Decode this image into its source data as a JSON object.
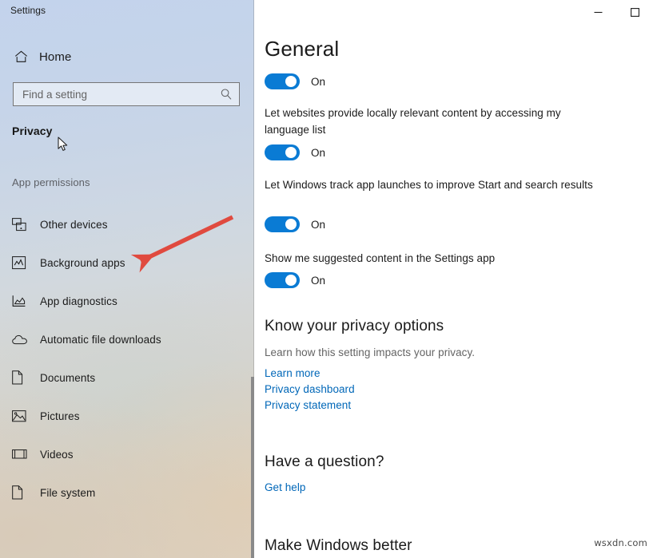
{
  "window": {
    "title": "Settings",
    "buttons": [
      {
        "name": "minimize",
        "glyph": "—"
      },
      {
        "name": "maximize",
        "glyph": "☐"
      }
    ]
  },
  "sidebar": {
    "home_label": "Home",
    "home_icon": "home-icon",
    "search": {
      "placeholder": "Find a setting",
      "value": "",
      "icon": "search-icon"
    },
    "section_title": "Privacy",
    "group_title": "App permissions",
    "items": [
      {
        "label": "Other devices",
        "icon": "other-devices-icon"
      },
      {
        "label": "Background apps",
        "icon": "background-apps-icon"
      },
      {
        "label": "App diagnostics",
        "icon": "app-diagnostics-icon"
      },
      {
        "label": "Automatic file downloads",
        "icon": "cloud-download-icon"
      },
      {
        "label": "Documents",
        "icon": "document-icon"
      },
      {
        "label": "Pictures",
        "icon": "pictures-icon"
      },
      {
        "label": "Videos",
        "icon": "video-icon"
      },
      {
        "label": "File system",
        "icon": "file-system-icon"
      }
    ]
  },
  "main": {
    "heading": "General",
    "settings": [
      {
        "description": "",
        "toggle_state": "On"
      },
      {
        "description": "Let websites provide locally relevant content by accessing my language list",
        "toggle_state": "On"
      },
      {
        "description": "Let Windows track app launches to improve Start and search results",
        "toggle_state": "On"
      },
      {
        "description": "Show me suggested content in the Settings app",
        "toggle_state": "On"
      }
    ],
    "privacy_section": {
      "heading": "Know your privacy options",
      "subtitle": "Learn how this setting impacts your privacy.",
      "links": [
        "Learn more",
        "Privacy dashboard",
        "Privacy statement"
      ]
    },
    "question_section": {
      "heading": "Have a question?",
      "links": [
        "Get help"
      ]
    },
    "feedback_section": {
      "heading": "Make Windows better"
    },
    "watermark": "wsxdn.com"
  },
  "colors": {
    "accent": "#0a7bd4",
    "link": "#0067b8",
    "annotation": "#e04a3f",
    "text": "#1b1b1b",
    "muted": "#646464"
  }
}
